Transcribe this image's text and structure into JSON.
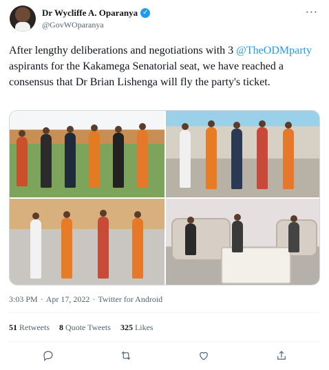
{
  "author": {
    "name": "Dr Wycliffe A. Oparanya",
    "handle": "@GovWOparanya",
    "verified_glyph": "✓"
  },
  "more_glyph": "···",
  "tweet": {
    "text_before": "After lengthy deliberations and negotiations with 3 ",
    "mention": "@TheODMparty",
    "text_after": " aspirants for the Kakamega Senatorial seat, we have reached a consensus that Dr Brian Lishenga will fly the party's ticket."
  },
  "meta": {
    "time": "3:03 PM",
    "separator1": "·",
    "date": "Apr 17, 2022",
    "separator2": "·",
    "source": "Twitter for Android"
  },
  "stats": {
    "retweets_count": "51",
    "retweets_label": "Retweets",
    "quotes_count": "8",
    "quotes_label": "Quote Tweets",
    "likes_count": "325",
    "likes_label": "Likes"
  },
  "colors": {
    "link_blue": "#1d9bf0",
    "text_gray": "#536471"
  },
  "icons": [
    "reply-icon",
    "retweet-icon",
    "like-icon",
    "share-icon"
  ]
}
